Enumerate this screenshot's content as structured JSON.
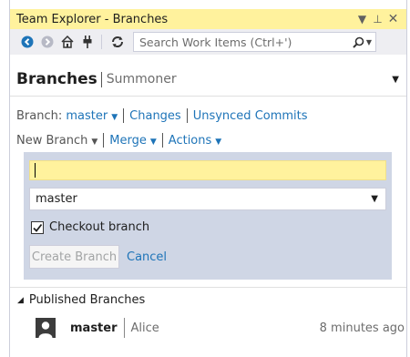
{
  "window": {
    "title": "Team Explorer - Branches"
  },
  "toolbar": {
    "search_placeholder": "Search Work Items (Ctrl+')"
  },
  "header": {
    "title": "Branches",
    "subtitle": "Summoner"
  },
  "nav": {
    "branch_label": "Branch:",
    "branch_value": "master",
    "changes": "Changes",
    "unsynced": "Unsynced Commits",
    "new_branch": "New Branch",
    "merge": "Merge",
    "actions": "Actions"
  },
  "create_branch": {
    "name_value": "",
    "source_branch": "master",
    "checkout_label": "Checkout branch",
    "checkout_checked": true,
    "create_button": "Create Branch",
    "cancel": "Cancel"
  },
  "published": {
    "section_title": "Published Branches",
    "branches": [
      {
        "name": "master",
        "owner": "Alice",
        "time": "8 minutes ago"
      }
    ]
  },
  "colors": {
    "accent": "#1e74b8",
    "highlight": "#fff29d",
    "form_bg": "#cfd6e5"
  }
}
